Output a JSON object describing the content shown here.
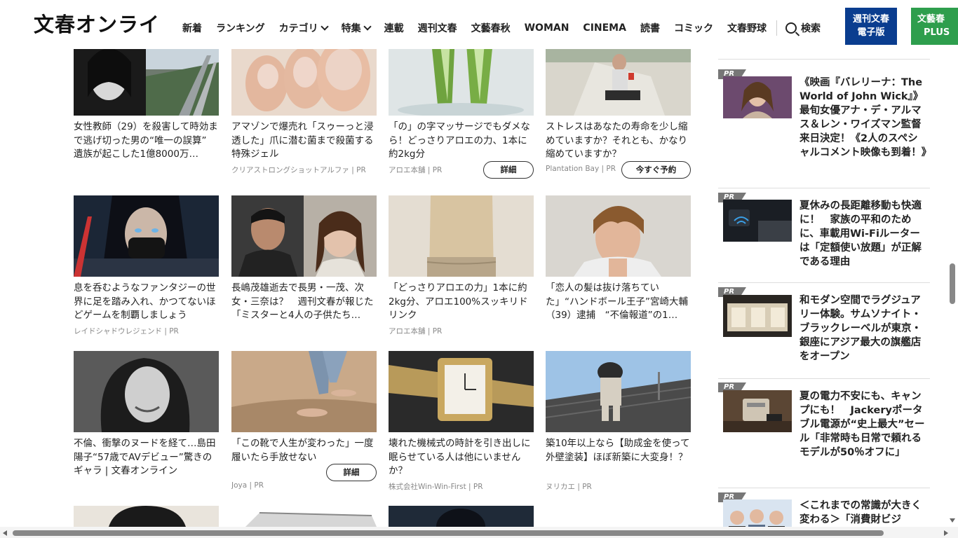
{
  "header": {
    "logo": "文春オンライン",
    "nav": [
      "新着",
      "ランキング",
      "カテゴリ",
      "特集",
      "連載",
      "週刊文春",
      "文藝春秋",
      "WOMAN",
      "CINEMA",
      "読書",
      "コミック",
      "文春野球"
    ],
    "search_label": "検索",
    "weekly_line1": "週刊文春",
    "weekly_line2": "電子版",
    "plus_line1": "文藝春",
    "plus_line2": "PLUS"
  },
  "cards": [
    {
      "title": "女性教師（29）を殺害して時効まで逃げ切った男の“唯一の誤算” 遺族が起こした1億8000万…",
      "meta": ""
    },
    {
      "title": "アマゾンで爆売れ「スゥーっと浸透した」爪に潜む菌まで殺菌する特殊ジェル",
      "meta": "クリアストロングショットアルファ | PR"
    },
    {
      "title": "「の」の字マッサージでもダメなら！どっさりアロエの力、1本に約2kg分",
      "meta": "アロエ本舗 | PR",
      "cta": "詳細"
    },
    {
      "title": "ストレスはあなたの寿命を少し縮めていますか？それとも、かなり縮めていますか？",
      "meta": "Plantation Bay | PR",
      "cta": "今すぐ予約"
    },
    {
      "title": "息を呑むようなファンタジーの世界に足を踏み入れ、かつてないほどゲームを制覇しましょう",
      "meta": "レイドシャドウレジェンド | PR"
    },
    {
      "title": "長嶋茂雄逝去で長男・一茂、次女・三奈は？　週刊文春が報じた「ミスターと4人の子供たち…",
      "meta": ""
    },
    {
      "title": "「どっさりアロエの力」1本に約2kg分、アロエ100%スッキリドリンク",
      "meta": "アロエ本舗 | PR"
    },
    {
      "title": "「恋人の髪は抜け落ちていた」“ハンドボール王子”宮崎大輔（39）逮捕　“不倫報道”の1…",
      "meta": ""
    },
    {
      "title": "不倫、衝撃のヌードを経て…島田陽子“57歳でAVデビュー”驚きのギャラ | 文春オンライン",
      "meta": ""
    },
    {
      "title": "「この靴で人生が変わった」一度履いたら手放せない",
      "meta": "Joya | PR",
      "cta": "詳細"
    },
    {
      "title": "壊れた機械式の時計を引き出しに眠らせている人は他にいませんか？",
      "meta": "株式会社Win-Win-First | PR"
    },
    {
      "title": "築10年以上なら【助成金を使って外壁塗装】ほぼ新築に大変身！？",
      "meta": "ヌリカエ | PR"
    }
  ],
  "sidebar": {
    "pr_label": "PR",
    "items": [
      {
        "title": "《映画『バレリーナ：The World of John Wick』》最旬女優アナ・デ・アルマス＆レン・ワイズマン監督来日決定！《2人のスペシャルコメント映像も到着！》"
      },
      {
        "title": "夏休みの長距離移動も快適に！　家族の平和のために、車載用Wi-Fiルーターは「定額使い放題」が正解である理由"
      },
      {
        "title": "和モダン空間でラグジュアリー体験。サムソナイト・ブラックレーベルが東京・銀座にアジア最大の旗艦店をオープン"
      },
      {
        "title": "夏の電力不安にも、キャンプにも！　Jackeryポータブル電源が“史上最大”セール「非常時も日常で頼れるモデルが50％オフに」"
      },
      {
        "title": "＜これまでの常識が大きく変わる＞「消費財ビジ"
      }
    ]
  }
}
